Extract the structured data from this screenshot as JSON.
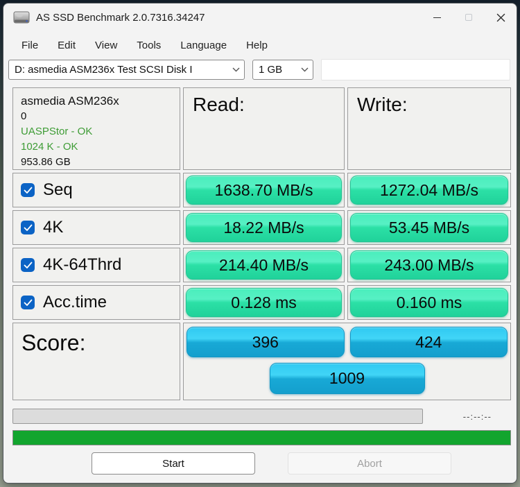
{
  "window": {
    "title": "AS SSD Benchmark 2.0.7316.34247"
  },
  "menu": {
    "items": [
      "File",
      "Edit",
      "View",
      "Tools",
      "Language",
      "Help"
    ]
  },
  "toolbar": {
    "drive_select_value": "D: asmedia ASM236x Test SCSI Disk I",
    "size_select_value": "1 GB",
    "free_field_value": ""
  },
  "drive_info": {
    "model": "asmedia ASM236x",
    "partition": "0",
    "driver_status": "UASPStor - OK",
    "alignment_status": "1024 K - OK",
    "capacity": "953.86 GB"
  },
  "columns": {
    "read": "Read:",
    "write": "Write:"
  },
  "tests": [
    {
      "label": "Seq",
      "checked": true,
      "read": "1638.70 MB/s",
      "write": "1272.04 MB/s"
    },
    {
      "label": "4K",
      "checked": true,
      "read": "18.22 MB/s",
      "write": "53.45 MB/s"
    },
    {
      "label": "4K-64Thrd",
      "checked": true,
      "read": "214.40 MB/s",
      "write": "243.00 MB/s"
    },
    {
      "label": "Acc.time",
      "checked": true,
      "read": "0.128 ms",
      "write": "0.160 ms"
    }
  ],
  "score": {
    "label": "Score:",
    "read": "396",
    "write": "424",
    "total": "1009"
  },
  "progress": {
    "time_remaining": "--:--:--"
  },
  "actions": {
    "start": "Start",
    "abort": "Abort"
  },
  "colors": {
    "result_pill_green": "#2ce0a6",
    "score_pill_blue": "#18a9d6",
    "status_bar_green": "#12a52e",
    "checkbox_blue": "#0b63c5",
    "ok_text_green": "#3e9c35"
  }
}
